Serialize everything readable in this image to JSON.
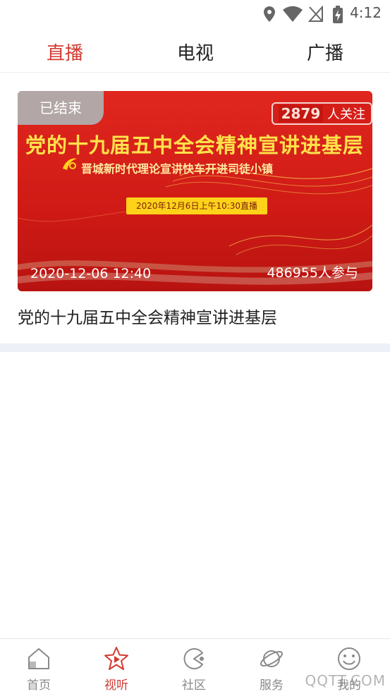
{
  "status_bar": {
    "time": "4:12"
  },
  "tabs": [
    {
      "label": "直播",
      "active": true
    },
    {
      "label": "电视",
      "active": false
    },
    {
      "label": "广播",
      "active": false
    }
  ],
  "card": {
    "status_tag": "已结束",
    "follow_count": "2879",
    "follow_label": "人关注",
    "banner_title": "党的十九届五中全会精神宣讲进基层",
    "banner_subtitle": "晋城新时代理论宣讲快车开进司徒小镇",
    "banner_date": "2020年12月6日上午10:30直播",
    "time": "2020-12-06 12:40",
    "participants": "486955人参与",
    "title": "党的十九届五中全会精神宣讲进基层"
  },
  "bottom_nav": [
    {
      "label": "首页",
      "icon": "home-icon",
      "active": false
    },
    {
      "label": "视听",
      "icon": "play-star-icon",
      "active": true
    },
    {
      "label": "社区",
      "icon": "community-icon",
      "active": false
    },
    {
      "label": "服务",
      "icon": "planet-icon",
      "active": false
    },
    {
      "label": "我的",
      "icon": "smiley-icon",
      "active": false
    }
  ],
  "watermark": "QQTT.COM",
  "colors": {
    "accent": "#d23a32",
    "banner_red": "#d61e19",
    "divider": "#edf0f7"
  }
}
